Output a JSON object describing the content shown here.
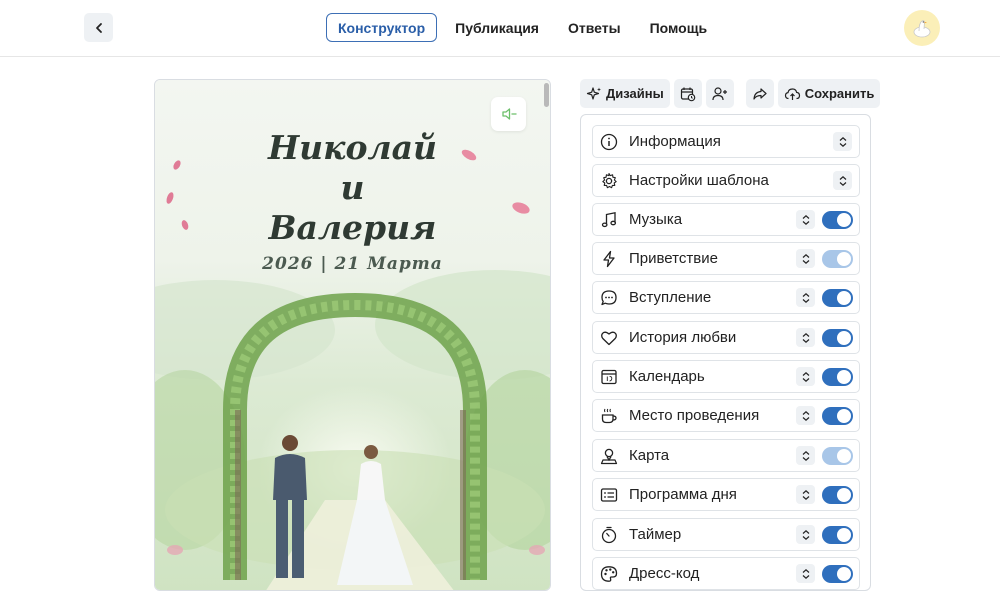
{
  "header": {
    "nav": [
      "Конструктор",
      "Публикация",
      "Ответы",
      "Помощь"
    ],
    "active_nav": "Конструктор"
  },
  "preview": {
    "names_line1": "Николай",
    "names_line2": "и",
    "names_line3": "Валерия",
    "date": "2026 | 21 Марта"
  },
  "toolbar": {
    "designs_label": "Дизайны",
    "save_label": "Сохранить"
  },
  "sections": [
    {
      "label": "Информация",
      "icon": "info-icon",
      "toggle": null
    },
    {
      "label": "Настройки шаблона",
      "icon": "gear-icon",
      "toggle": null
    },
    {
      "label": "Музыка",
      "icon": "music-icon",
      "toggle": "on"
    },
    {
      "label": "Приветствие",
      "icon": "lightning-icon",
      "toggle": "disabled"
    },
    {
      "label": "Вступление",
      "icon": "chat-icon",
      "toggle": "on"
    },
    {
      "label": "История любви",
      "icon": "heart-icon",
      "toggle": "on"
    },
    {
      "label": "Календарь",
      "icon": "calendar-icon",
      "toggle": "on"
    },
    {
      "label": "Место проведения",
      "icon": "cup-icon",
      "toggle": "on"
    },
    {
      "label": "Карта",
      "icon": "map-pin-icon",
      "toggle": "disabled"
    },
    {
      "label": "Программа дня",
      "icon": "program-icon",
      "toggle": "on"
    },
    {
      "label": "Таймер",
      "icon": "timer-icon",
      "toggle": "on"
    },
    {
      "label": "Дресс-код",
      "icon": "palette-icon",
      "toggle": "on"
    }
  ],
  "colors": {
    "accent": "#2f6fbd",
    "accent_light": "#a8c6e8",
    "button_bg": "#eef1f4"
  }
}
